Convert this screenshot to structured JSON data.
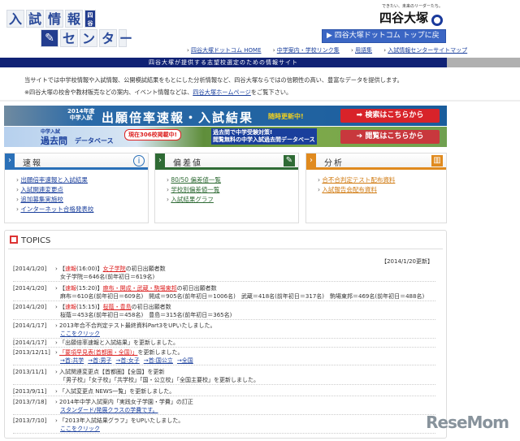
{
  "logo": {
    "row1": [
      "入",
      "試",
      "情",
      "報"
    ],
    "badge": "四谷大塚",
    "row2": [
      "セ",
      "ン",
      "タ",
      "ー"
    ]
  },
  "brand": {
    "tagline": "できたい、未来のリーダーたち。",
    "name": "四谷大塚"
  },
  "top_button": "▶ 四谷大塚ドットコム トップに戻る",
  "top_links": [
    "四谷大塚ドットコム HOME",
    "中学案内・学校リンク集",
    "用語集",
    "入試情報センターサイトマップ"
  ],
  "nav_bar": "四谷大塚が提供する志望校選定のための情報サイト",
  "intro": {
    "line1": "当サイトでは中学校情報や入試情報、公開模試結果をもとにした分析情報など、四谷大塚ならではの信頼性の高い、豊富なデータを提供します。",
    "line2_pre": "※四谷大塚の校舎や教材販売などの案内、イベント情報などは、",
    "line2_link": "四谷大塚ホームページ",
    "line2_post": "をご覧下さい。"
  },
  "banner1": {
    "year": "2014年度",
    "sub": "中学入試",
    "title": "出願倍率速報・入試結果",
    "note": "随時更新中!",
    "button": "➡ 検索はこちらから"
  },
  "banner2": {
    "label1": "中学入試",
    "label2": "過去問",
    "label3": "データベース",
    "count": "現在306校掲載中!",
    "desc1": "過去問で中学受験対策!",
    "desc2": "閲覧無料の中学入試過去問データベース",
    "button": "➔ 閲覧はこちらから"
  },
  "boxes": [
    {
      "title": "速報",
      "color": "#2a70b8",
      "items": [
        "出願倍率速報と入試結果",
        "入試関連変更点",
        "追加募集実施校",
        "インターネット合格発表校"
      ]
    },
    {
      "title": "偏差値",
      "color": "#2f6b35",
      "items": [
        "80/50 偏差値一覧",
        "学校別偏差値一覧",
        "入試結果グラフ"
      ]
    },
    {
      "title": "分析",
      "color": "#e08a1e",
      "items": [
        "合不合判定テスト配布資料",
        "入試報告会配布資料"
      ]
    }
  ],
  "topics": {
    "title": "TOPICS",
    "updated": "【2014/1/20更新】",
    "rows": [
      {
        "date": "[2014/1/20]",
        "a": "【",
        "b": "速報",
        "c": "(16:00)】",
        "d": "女子学院",
        "e": "の初日出願者数",
        "sub": "女子学院＝646名(前年初日＝619名)"
      },
      {
        "date": "[2014/1/20]",
        "a": "【",
        "b": "速報",
        "c": "(15:20)】",
        "d": "麻布・開成・武蔵・駒場東邦",
        "e": "の初日出願者数",
        "sub": "麻布＝610名(前年初日＝609名)　開成＝905名(前年初日＝1006名)　武蔵＝418名(前年初日＝317名)　駒場東邦＝469名(前年初日＝488名)"
      },
      {
        "date": "[2014/1/20]",
        "a": "【",
        "b": "速報",
        "c": "(15:15)】",
        "d": "桜蔭・豊島",
        "e": "の初日出願者数",
        "sub": "桜蔭＝453名(前年初日＝458名)　豊島＝315名(前年初日＝365名)"
      },
      {
        "date": "[2014/1/17]",
        "text": "2013年合不合判定テスト最終資料Part3をUPいたしました。",
        "link": "ここをクリック"
      },
      {
        "date": "[2014/1/17]",
        "text": "「出願倍率速報と入試結果」を更新しました。"
      },
      {
        "date": "[2013/12/11]",
        "red": "「要項早見表(首都圏・全国)」",
        "text": "を更新しました。",
        "links": [
          "→首:共学",
          "→首:男子",
          "→首:女子",
          "→首:国公立",
          "→全国"
        ]
      },
      {
        "date": "[2013/11/1]",
        "text": "入試関連変更点【首都圏】【全国】を更新",
        "sub": "「男子校」「女子校」「共学校」「国・公立校」「全国主要校」を更新しました。"
      },
      {
        "date": "[2013/9/11]",
        "text": "「入試変更点 NEWS一覧」を更新しました。"
      },
      {
        "date": "[2013/7/18]",
        "text": "2014年中学入試案内「実践女子学園・学費」の訂正",
        "link": "スタンダード/発展クラスの学費です。"
      },
      {
        "date": "[2013/7/10]",
        "text": "「2013年入試結果グラフ」をUPいたしました。",
        "link": "ここをクリック"
      }
    ]
  },
  "watermark": "ReseMom"
}
